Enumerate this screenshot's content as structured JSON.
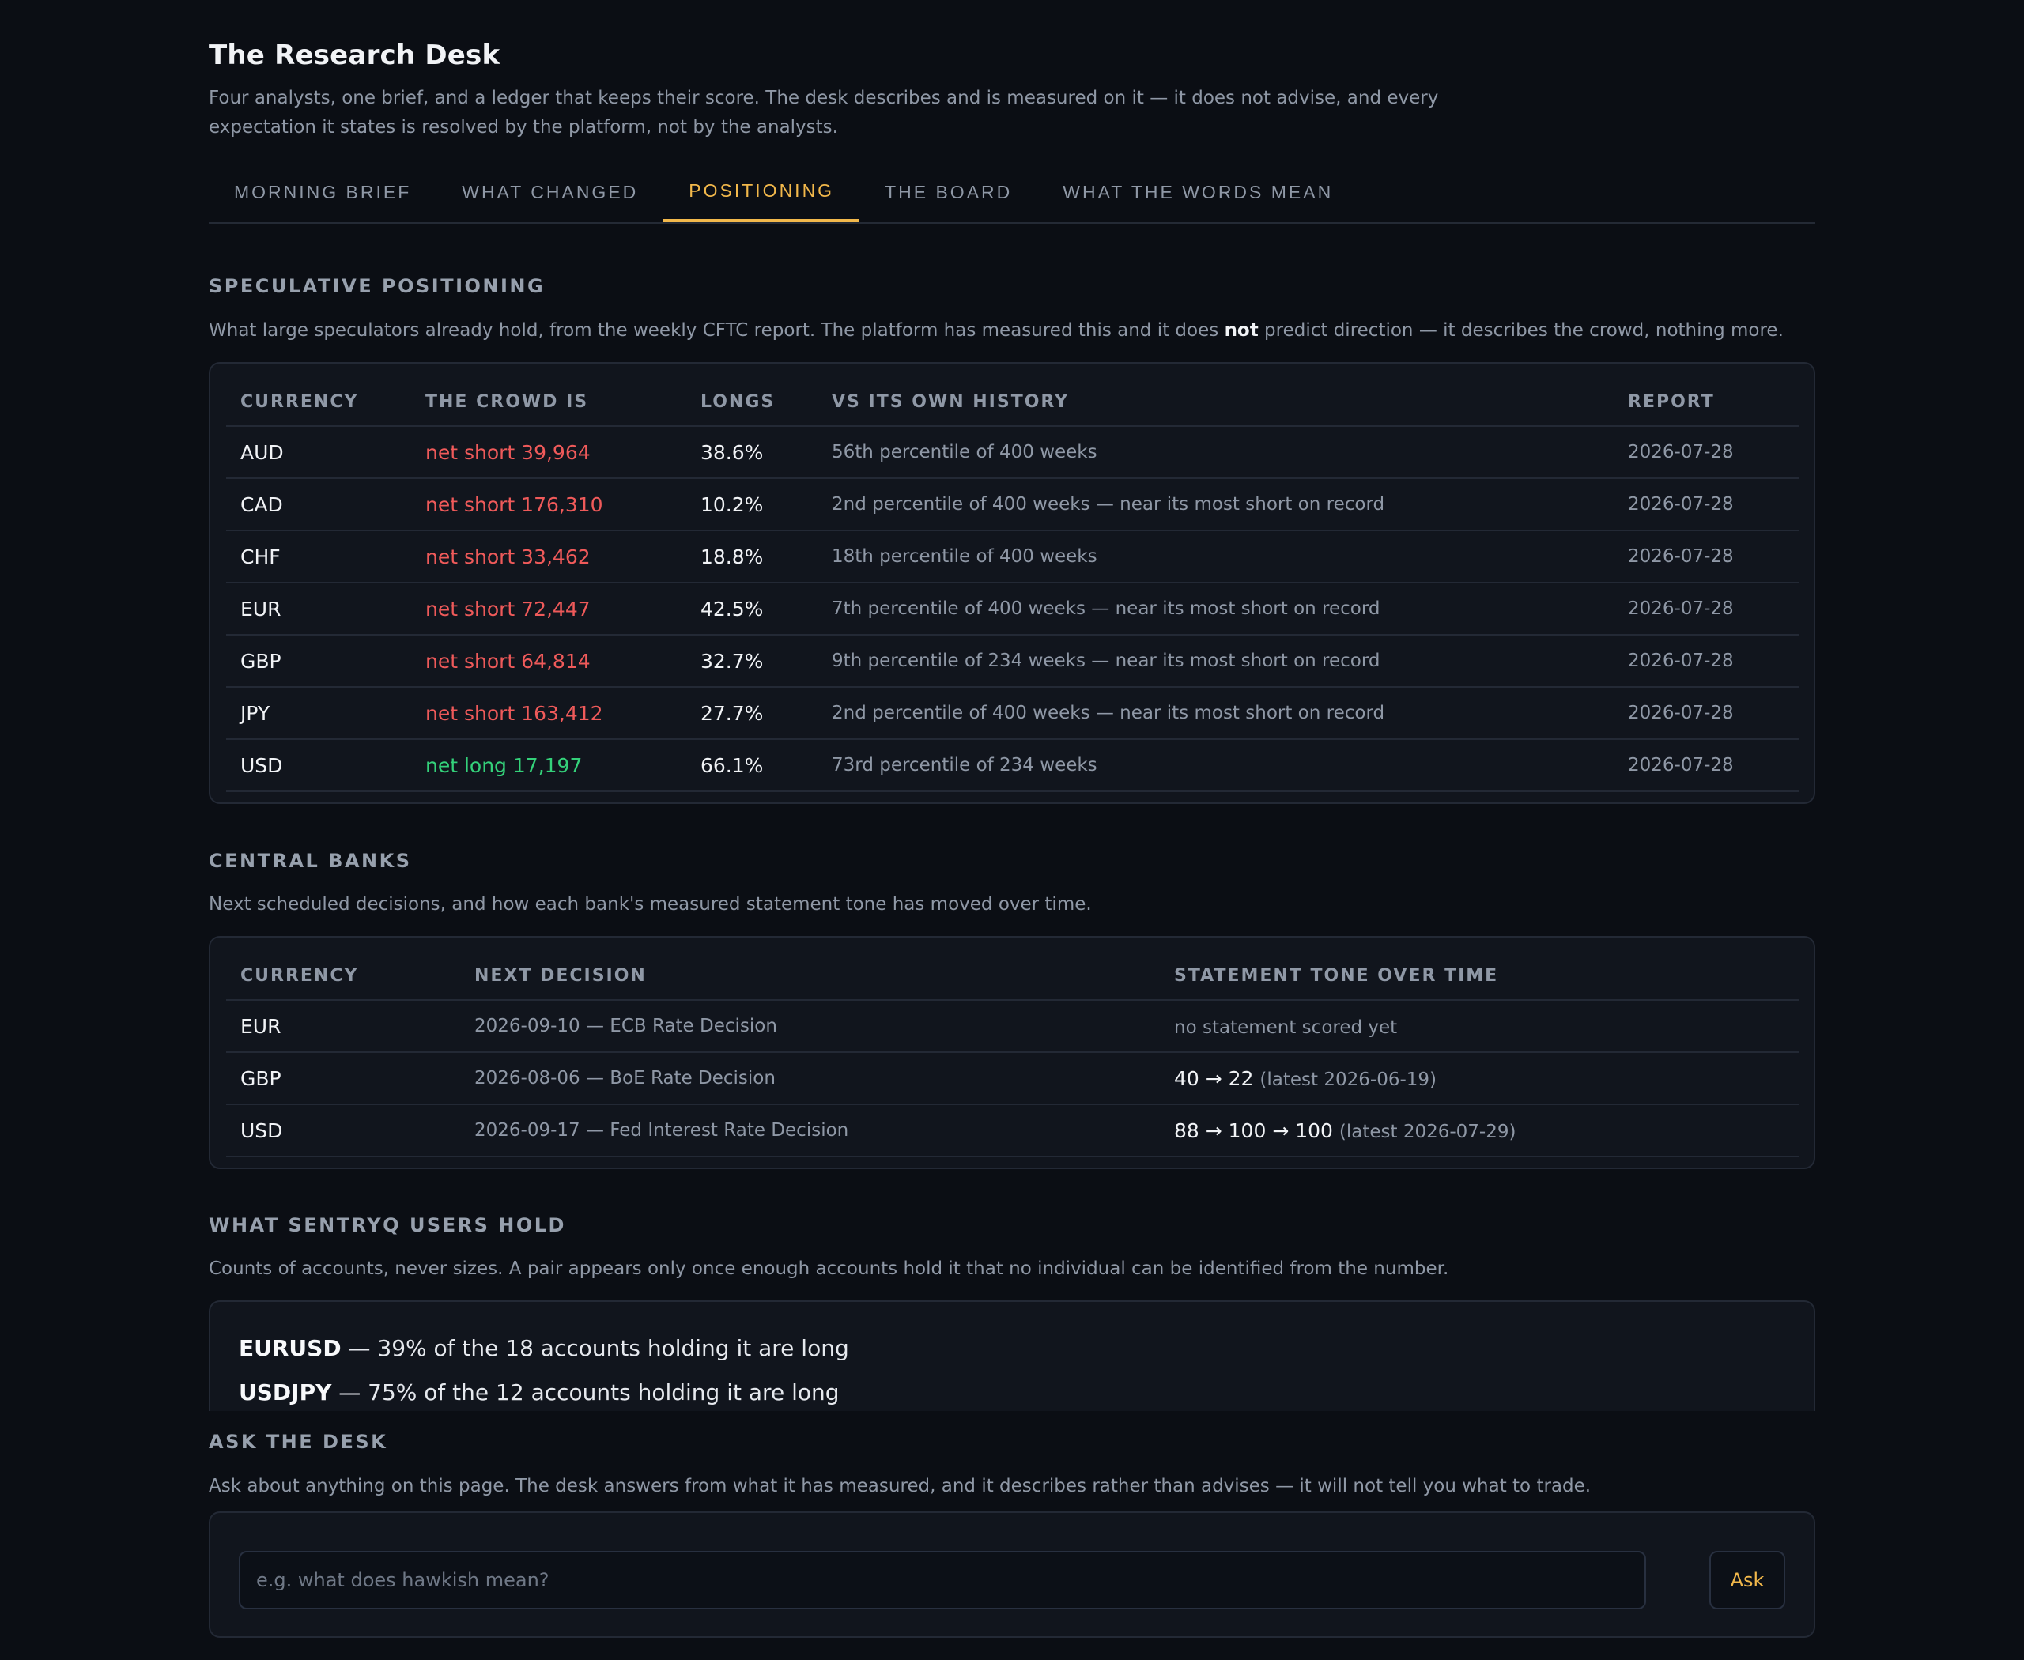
{
  "header": {
    "title": "The Research Desk",
    "subtitle": "Four analysts, one brief, and a ledger that keeps their score. The desk describes and is measured on it — it does not advise, and every expectation it states is resolved by the platform, not by the analysts."
  },
  "tabs": [
    {
      "label": "MORNING BRIEF",
      "active": false
    },
    {
      "label": "WHAT CHANGED",
      "active": false
    },
    {
      "label": "POSITIONING",
      "active": true
    },
    {
      "label": "THE BOARD",
      "active": false
    },
    {
      "label": "WHAT THE WORDS MEAN",
      "active": false
    }
  ],
  "positioning": {
    "title": "SPECULATIVE POSITIONING",
    "desc_before": "What large speculators already hold, from the weekly CFTC report. The platform has measured this and it does ",
    "desc_bold": "not",
    "desc_after": " predict direction — it describes the crowd, nothing more.",
    "headers": [
      "CURRENCY",
      "THE CROWD IS",
      "LONGS",
      "VS ITS OWN HISTORY",
      "REPORT"
    ],
    "rows": [
      {
        "currency": "AUD",
        "crowd": "net short 39,964",
        "side": "short",
        "longs": "38.6%",
        "history": "56th percentile of 400 weeks",
        "report": "2026-07-28"
      },
      {
        "currency": "CAD",
        "crowd": "net short 176,310",
        "side": "short",
        "longs": "10.2%",
        "history": "2nd percentile of 400 weeks — near its most short on record",
        "report": "2026-07-28"
      },
      {
        "currency": "CHF",
        "crowd": "net short 33,462",
        "side": "short",
        "longs": "18.8%",
        "history": "18th percentile of 400 weeks",
        "report": "2026-07-28"
      },
      {
        "currency": "EUR",
        "crowd": "net short 72,447",
        "side": "short",
        "longs": "42.5%",
        "history": "7th percentile of 400 weeks — near its most short on record",
        "report": "2026-07-28"
      },
      {
        "currency": "GBP",
        "crowd": "net short 64,814",
        "side": "short",
        "longs": "32.7%",
        "history": "9th percentile of 234 weeks — near its most short on record",
        "report": "2026-07-28"
      },
      {
        "currency": "JPY",
        "crowd": "net short 163,412",
        "side": "short",
        "longs": "27.7%",
        "history": "2nd percentile of 400 weeks — near its most short on record",
        "report": "2026-07-28"
      },
      {
        "currency": "USD",
        "crowd": "net long 17,197",
        "side": "long",
        "longs": "66.1%",
        "history": "73rd percentile of 234 weeks",
        "report": "2026-07-28"
      }
    ],
    "colors": {
      "short": "#ef5a5a",
      "long": "#34d17a"
    }
  },
  "central_banks": {
    "title": "CENTRAL BANKS",
    "desc": "Next scheduled decisions, and how each bank's measured statement tone has moved over time.",
    "headers": [
      "CURRENCY",
      "NEXT DECISION",
      "STATEMENT TONE OVER TIME"
    ],
    "rows": [
      {
        "currency": "EUR",
        "next": "2026-09-10 — ECB Rate Decision",
        "tone": "",
        "tone_note": "no statement scored yet"
      },
      {
        "currency": "GBP",
        "next": "2026-08-06 — BoE Rate Decision",
        "tone": "40 → 22",
        "tone_note": "(latest 2026-06-19)"
      },
      {
        "currency": "USD",
        "next": "2026-09-17 — Fed Interest Rate Decision",
        "tone": "88 → 100 → 100",
        "tone_note": "(latest 2026-07-29)"
      }
    ]
  },
  "users_hold": {
    "title": "WHAT SENTRYQ USERS HOLD",
    "desc": "Counts of accounts, never sizes. A pair appears only once enough accounts hold it that no individual can be identified from the number.",
    "items": [
      {
        "pair": "EURUSD",
        "text": " — 39% of the 18 accounts holding it are long"
      },
      {
        "pair": "USDJPY",
        "text": " — 75% of the 12 accounts holding it are long"
      }
    ]
  },
  "ask": {
    "title": "ASK THE DESK",
    "desc": "Ask about anything on this page. The desk answers from what it has measured, and it describes rather than advises — it will not tell you what to trade.",
    "placeholder": "e.g. what does hawkish mean?",
    "value": "",
    "button": "Ask"
  },
  "theme": {
    "accent": "#f2b84b",
    "background": "#0b0e14",
    "card": "#11151d"
  }
}
